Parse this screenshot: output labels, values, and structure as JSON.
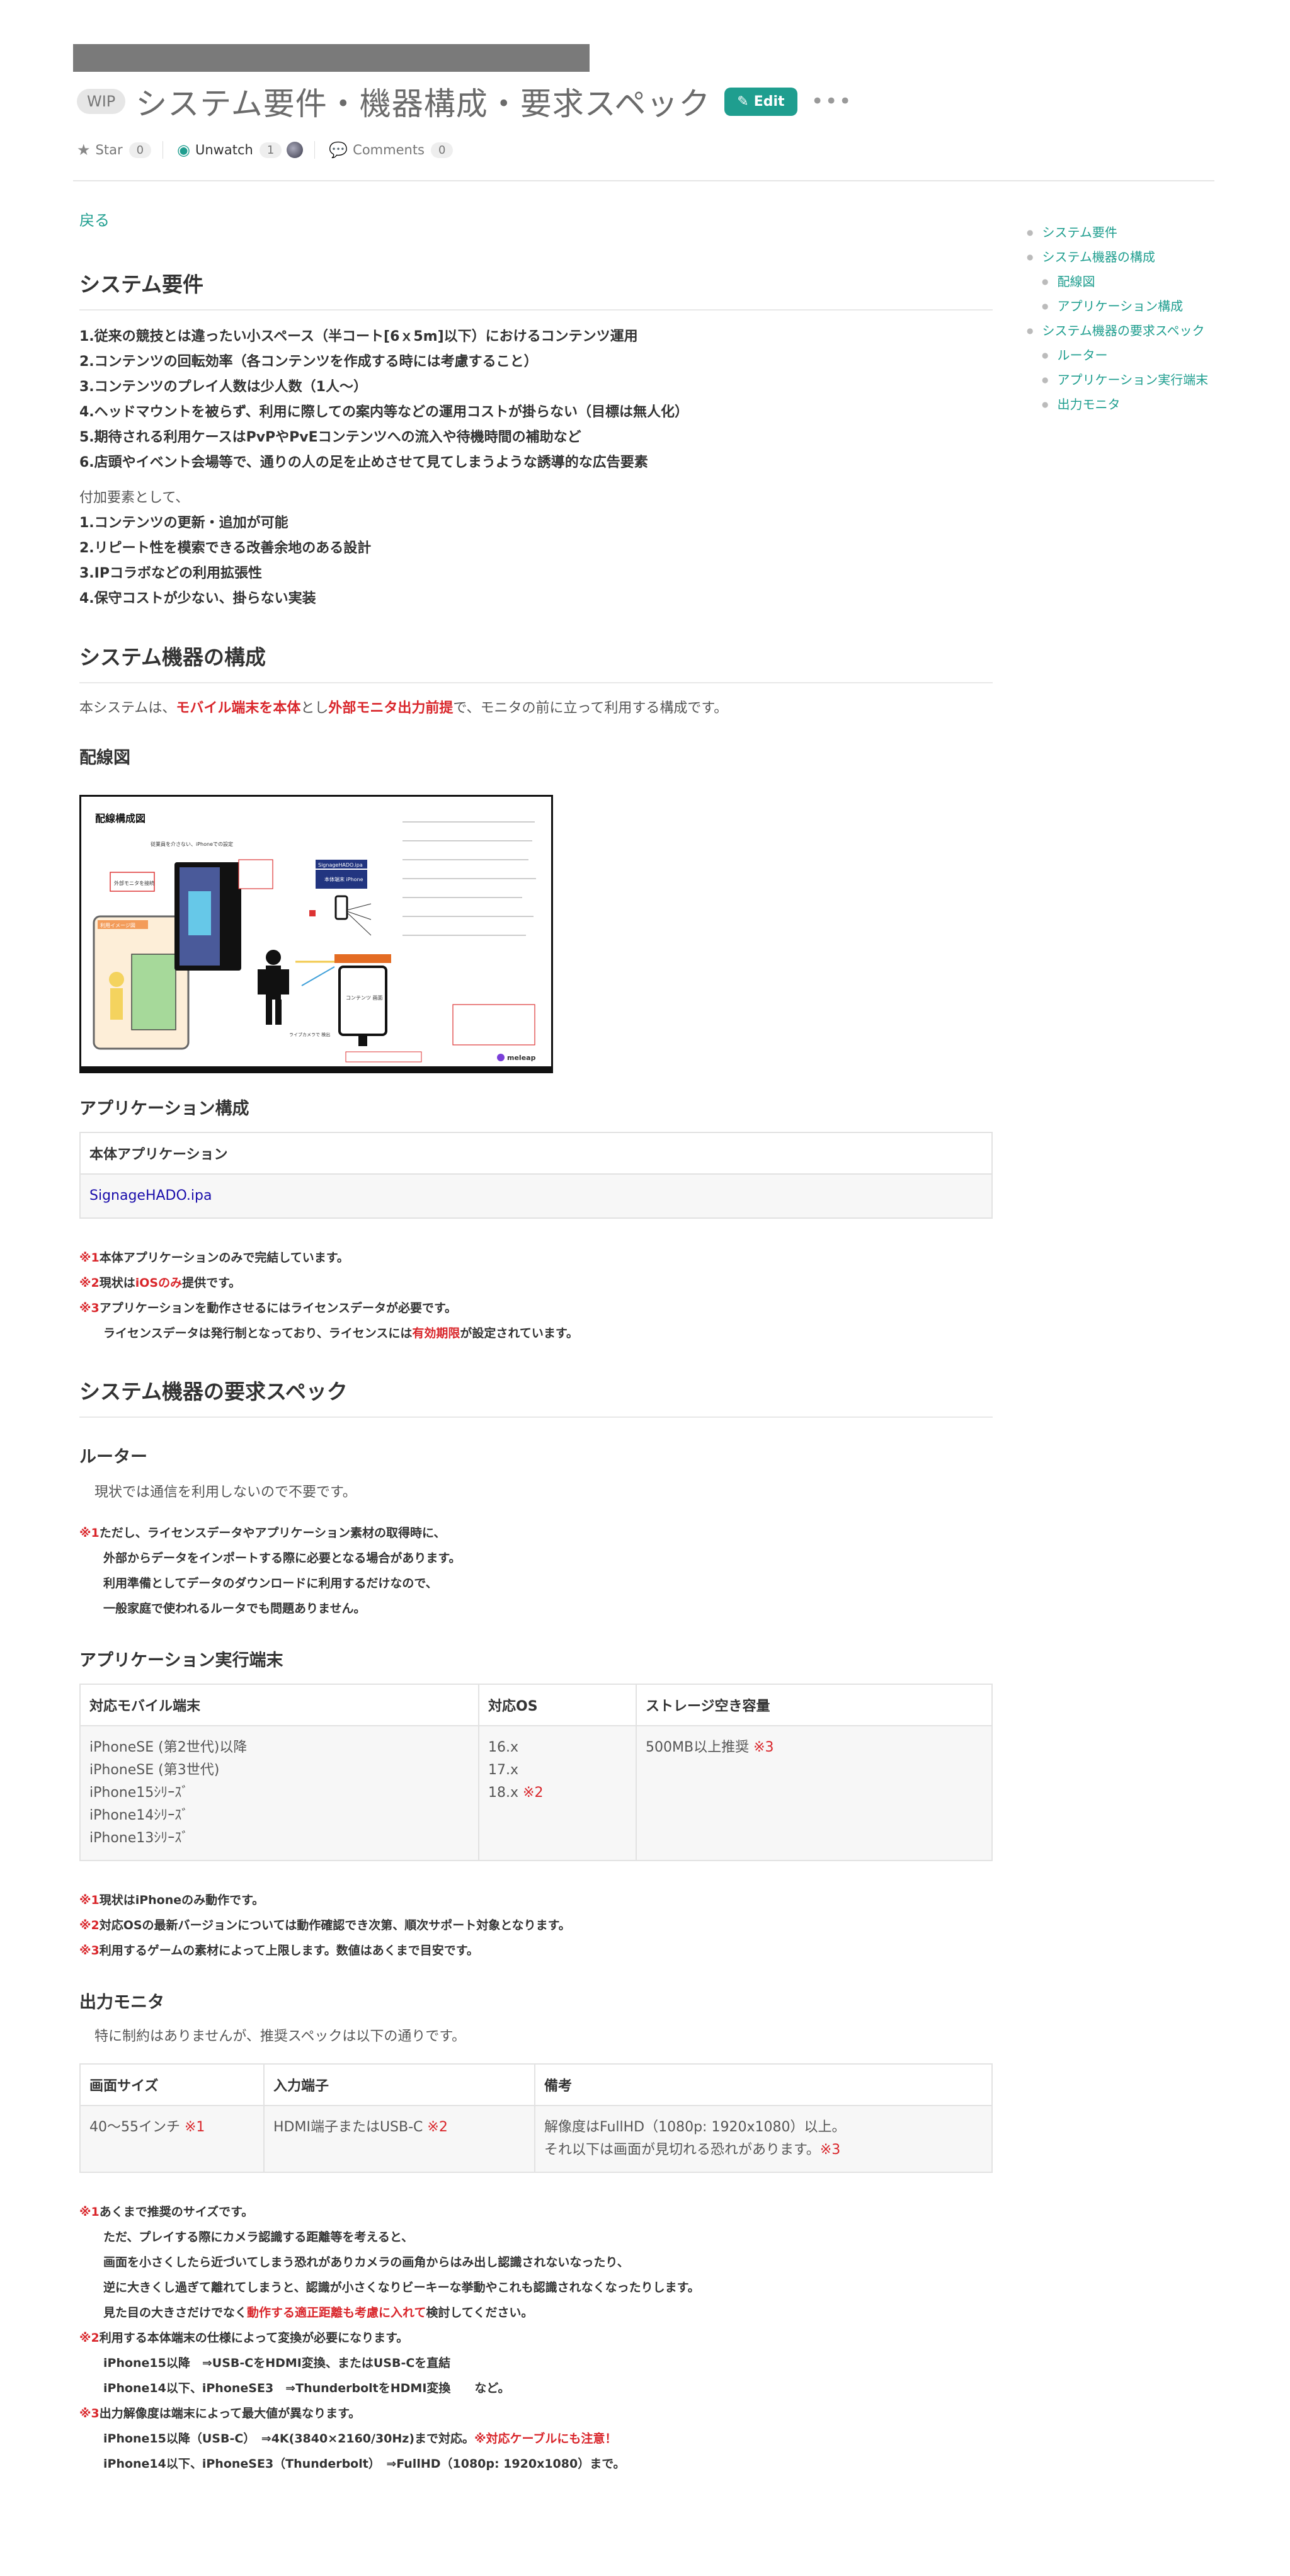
{
  "header": {
    "wip": "WIP",
    "title": "システム要件・機器構成・要求スペック",
    "edit_label": "Edit",
    "star_label": "Star",
    "star_count": "0",
    "unwatch_label": "Unwatch",
    "watch_count": "1",
    "comments_label": "Comments",
    "comments_count": "0"
  },
  "back": "戻る",
  "toc": {
    "items": [
      {
        "label": "システム要件"
      },
      {
        "label": "システム機器の構成"
      },
      {
        "label": "配線図"
      },
      {
        "label": "アプリケーション構成"
      },
      {
        "label": "システム機器の要求スペック"
      },
      {
        "label": "ルーター"
      },
      {
        "label": "アプリケーション実行端末"
      },
      {
        "label": "出力モニタ"
      }
    ]
  },
  "requirements": {
    "heading": "システム要件",
    "items": [
      "1.従来の競技とは違ったい小スペース（半コート[6ｘ5m]以下）におけるコンテンツ運用",
      "2.コンテンツの回転効率（各コンテンツを作成する時には考慮すること）",
      "3.コンテンツのプレイ人数は少人数（1人〜）",
      "4.ヘッドマウントを被らず、利用に際しての案内等などの運用コストが掛らない（目標は無人化）",
      "5.期待される利用ケースはPvPやPvEコンテンツへの流入や待機時間の補助など",
      "6.店頭やイベント会場等で、通りの人の足を止めさせて見てしまうような誘導的な広告要素"
    ],
    "extra_intro": "付加要素として、",
    "extra_items": [
      "1.コンテンツの更新・追加が可能",
      "2.リピート性を模索できる改善余地のある設計",
      "3.IPコラボなどの利用拡張性",
      "4.保守コストが少ない、掛らない実装"
    ]
  },
  "composition": {
    "heading": "システム機器の構成",
    "lead_before": "本システムは、",
    "lead_red1": "モバイル端末を本体",
    "lead_mid": "とし",
    "lead_red2": "外部モニタ出力前提",
    "lead_after": "で、モニタの前に立って利用する構成です。",
    "wiring_heading": "配線図",
    "diagram": {
      "title": "配線構成図",
      "note1": "従業員を介さない、iPhoneでの設定",
      "label_person_area": "利用イメージ図",
      "label_hdmi": "外部モニタを接続",
      "label_app": "SignageHADO.ipa",
      "label_iphone": "本体端末\niPhone",
      "label_monitor": "コンテンツ\n画面",
      "label_user": "ライブカメラで\n検出",
      "logo": "meleap"
    },
    "app_heading": "アプリケーション構成",
    "app_table_header": "本体アプリケーション",
    "app_table_value": "SignageHADO.ipa",
    "notes": [
      {
        "mark": "※1",
        "text": "本体アプリケーションのみで完結しています。"
      },
      {
        "mark": "※2",
        "pre": "現状は",
        "red": "iOSのみ",
        "post": "提供です。"
      },
      {
        "mark": "※3",
        "text": "アプリケーションを動作させるにはライセンスデータが必要です。"
      }
    ],
    "note_indent_pre": "ライセンスデータは発行制となっており、ライセンスには",
    "note_indent_red": "有効期限",
    "note_indent_post": "が設定されています。"
  },
  "specs": {
    "heading": "システム機器の要求スペック",
    "router": {
      "heading": "ルーター",
      "text": "現状では通信を利用しないので不要です。",
      "note_mark": "※1",
      "note_lines": [
        "ただし、ライセンスデータやアプリケーション素材の取得時に、",
        "外部からデータをインポートする際に必要となる場合があります。",
        "利用準備としてデータのダウンロードに利用するだけなので、",
        "一般家庭で使われるルータでも問題ありません。"
      ]
    },
    "device": {
      "heading": "アプリケーション実行端末",
      "headers": [
        "対応モバイル端末",
        "対応OS",
        "ストレージ空き容量"
      ],
      "devices": [
        "iPhoneSE (第2世代)以降",
        "iPhoneSE (第3世代)",
        "iPhone15ｼﾘｰｽﾞ",
        "iPhone14ｼﾘｰｽﾞ",
        "iPhone13ｼﾘｰｽﾞ"
      ],
      "os": [
        "16.x",
        "17.x",
        "18.x"
      ],
      "os_mark": "※2",
      "storage": "500MB以上推奨",
      "storage_mark": "※3",
      "notes": [
        {
          "mark": "※1",
          "text": "現状はiPhoneのみ動作です。"
        },
        {
          "mark": "※2",
          "text": "対応OSの最新バージョンについては動作確認でき次第、順次サポート対象となります。"
        },
        {
          "mark": "※3",
          "text": "利用するゲームの素材によって上限します。数値はあくまで目安です。"
        }
      ]
    },
    "monitor": {
      "heading": "出力モニタ",
      "text": "特に制約はありませんが、推奨スペックは以下の通りです。",
      "headers": [
        "画面サイズ",
        "入力端子",
        "備考"
      ],
      "size": "40〜55インチ",
      "size_mark": "※1",
      "input": "HDMI端子またはUSB-C",
      "input_mark": "※2",
      "remark1": "解像度はFullHD（1080p: 1920x1080）以上。",
      "remark2": "それ以下は画面が見切れる恐れがあります。",
      "remark_mark": "※3",
      "note1_mark": "※1",
      "note1_title": "あくまで推奨のサイズです。",
      "note1_lines": [
        "ただ、プレイする際にカメラ認識する距離等を考えると、",
        "画面を小さくしたら近づいてしまう恐れがありカメラの画角からはみ出し認識されないなったり、",
        "逆に大きくし過ぎて離れてしまうと、認識が小さくなりビーキーな挙動やこれも認識されなくなったりします。"
      ],
      "note1_last_pre": "見た目の大きさだけでなく",
      "note1_last_red": "動作する適正距離も考慮に入れて",
      "note1_last_post": "検討してください。",
      "note2_mark": "※2",
      "note2_title": "利用する本体端末の仕様によって変換が必要になります。",
      "note2_lines": [
        "iPhone15以降　⇒USB-CをHDMI変換、またはUSB-Cを直結",
        "iPhone14以下、iPhoneSE3　⇒ThunderboltをHDMI変換　　など。"
      ],
      "note3_mark": "※3",
      "note3_title": "出力解像度は端末によって最大値が異なります。",
      "note3_line1_pre": "iPhone15以降（USB-C）　⇒4K(3840×2160/30Hz)まで対応。",
      "note3_line1_red": "※対応ケーブルにも注意！",
      "note3_line2": "iPhone14以下、iPhoneSE3（Thunderbolt）　⇒FullHD（1080p: 1920x1080）まで。"
    }
  },
  "colors": {
    "accent": "#1f9e8f",
    "warning": "#d9262b",
    "link": "#1a0dab"
  }
}
